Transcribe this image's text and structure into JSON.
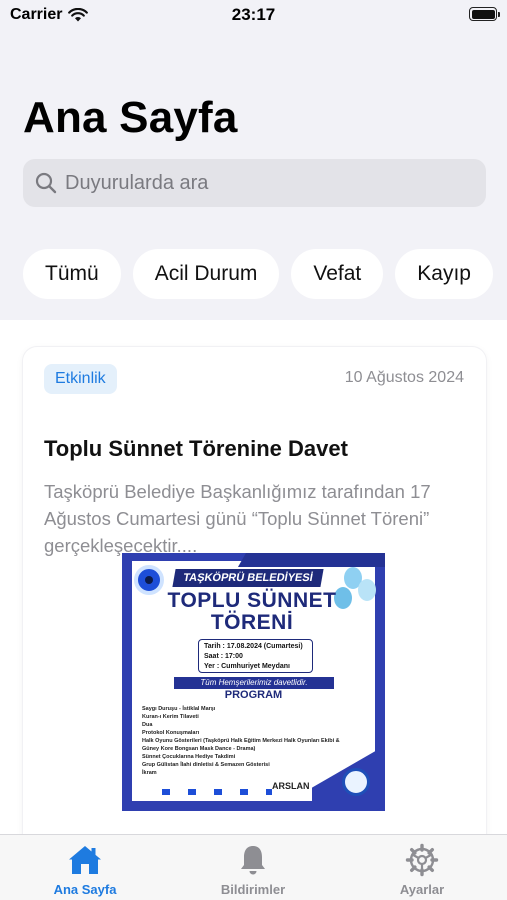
{
  "status_bar": {
    "carrier": "Carrier",
    "time": "23:17"
  },
  "page_title": "Ana Sayfa",
  "search": {
    "placeholder": "Duyurularda ara",
    "value": ""
  },
  "filters": [
    "Tümü",
    "Acil Durum",
    "Vefat",
    "Kayıp"
  ],
  "announcement": {
    "category": "Etkinlik",
    "date": "10 Ağustos 2024",
    "title": "Toplu Sünnet Törenine Davet",
    "body": "Taşköprü Belediye Başkanlığımız tarafından 17 Ağustos Cumartesi günü “Toplu Sünnet Töreni” gerçekleşecektir....",
    "poster": {
      "header": "TAŞKÖPRÜ BELEDİYESİ",
      "title_line1": "TOPLU SÜNNET",
      "title_line2": "TÖRENİ",
      "details": [
        "Tarih : 17.08.2024 (Cumartesi)",
        "Saat : 17:00",
        "Yer : Cumhuriyet Meydanı"
      ],
      "invite": "Tüm Hemşerilerimiz davetlidir.",
      "program_title": "PROGRAM",
      "program": [
        "Saygı Duruşu - İstiklal Marşı",
        "Kuran-ı Kerim Tilaveti",
        "Dua",
        "Protokol Konuşmaları",
        "Halk Oyunu Gösterileri (Taşköprü Halk Eğitim Merkezi Halk Oyunları Ekibi & Güney Kore Bongsan Mask Dance - Drama)",
        "Sünnet Çocuklarına Hediye Takdimi",
        "Grup Gülistan İlahi dinletisi & Semazen Gösterisi",
        "İkram"
      ],
      "signature": "ARSLAN"
    }
  },
  "tabs": [
    {
      "label": "Ana Sayfa",
      "icon": "house-icon",
      "active": true
    },
    {
      "label": "Bildirimler",
      "icon": "bell-icon",
      "active": false
    },
    {
      "label": "Ayarlar",
      "icon": "gear-icon",
      "active": false
    }
  ],
  "colors": {
    "accent": "#1e7be0",
    "badge_bg": "#e4f0fb",
    "muted": "#8e8e93",
    "background": "#f2f2f7"
  }
}
